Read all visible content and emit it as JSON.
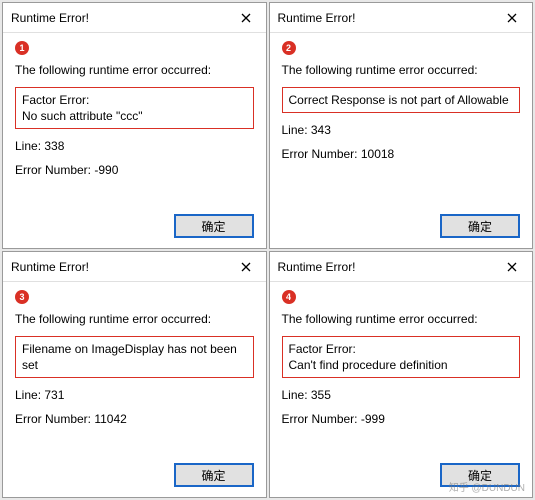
{
  "dialogs": [
    {
      "title": "Runtime Error!",
      "badge": "1",
      "heading": "The following runtime error occurred:",
      "error_text": "Factor Error:\nNo such attribute \"ccc\"",
      "line_label": "Line: 338",
      "errnum_label": "Error Number: -990",
      "ok_label": "确定"
    },
    {
      "title": "Runtime Error!",
      "badge": "2",
      "heading": "The following runtime error occurred:",
      "error_text": "Correct Response is not part of Allowable",
      "line_label": "Line: 343",
      "errnum_label": "Error Number: 10018",
      "ok_label": "确定"
    },
    {
      "title": "Runtime Error!",
      "badge": "3",
      "heading": "The following runtime error occurred:",
      "error_text": "Filename on ImageDisplay has not been set",
      "line_label": "Line: 731",
      "errnum_label": "Error Number: 11042",
      "ok_label": "确定"
    },
    {
      "title": "Runtime Error!",
      "badge": "4",
      "heading": "The following runtime error occurred:",
      "error_text": "Factor Error:\nCan't find procedure definition",
      "line_label": "Line: 355",
      "errnum_label": "Error Number: -999",
      "ok_label": "确定"
    }
  ],
  "watermark": "知乎 @DUNDUN"
}
